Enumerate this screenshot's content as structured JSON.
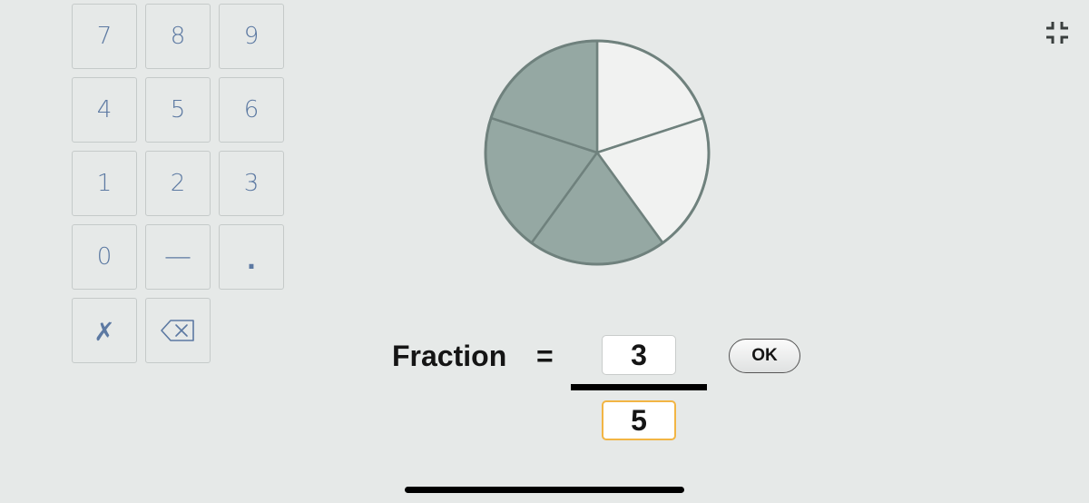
{
  "keypad": {
    "keys": [
      {
        "label": "7",
        "kind": "digit"
      },
      {
        "label": "8",
        "kind": "digit"
      },
      {
        "label": "9",
        "kind": "digit"
      },
      {
        "label": "4",
        "kind": "digit"
      },
      {
        "label": "5",
        "kind": "digit"
      },
      {
        "label": "6",
        "kind": "digit"
      },
      {
        "label": "1",
        "kind": "digit"
      },
      {
        "label": "2",
        "kind": "digit"
      },
      {
        "label": "3",
        "kind": "digit"
      },
      {
        "label": "0",
        "kind": "digit"
      },
      {
        "label": "—",
        "kind": "minus"
      },
      {
        "label": ".",
        "kind": "decimal"
      },
      {
        "label": "✗",
        "kind": "clear"
      },
      {
        "label": "",
        "kind": "backspace",
        "icon": "backspace-icon"
      }
    ]
  },
  "pie": {
    "total_slices": 5,
    "shaded_slices": 3,
    "shaded_color": "#95a8a3",
    "unshaded_color": "#f1f2f1",
    "outline_color": "#6f817d"
  },
  "fraction": {
    "label": "Fraction",
    "equals": "=",
    "numerator": "3",
    "denominator": "5",
    "ok_label": "OK"
  },
  "icons": {
    "collapse": "collapse-fullscreen-icon"
  },
  "colors": {
    "background": "#e6e9e8",
    "key_text": "#5c79a2",
    "key_border": "#c5cac9",
    "active_field_border": "#f2b544"
  }
}
